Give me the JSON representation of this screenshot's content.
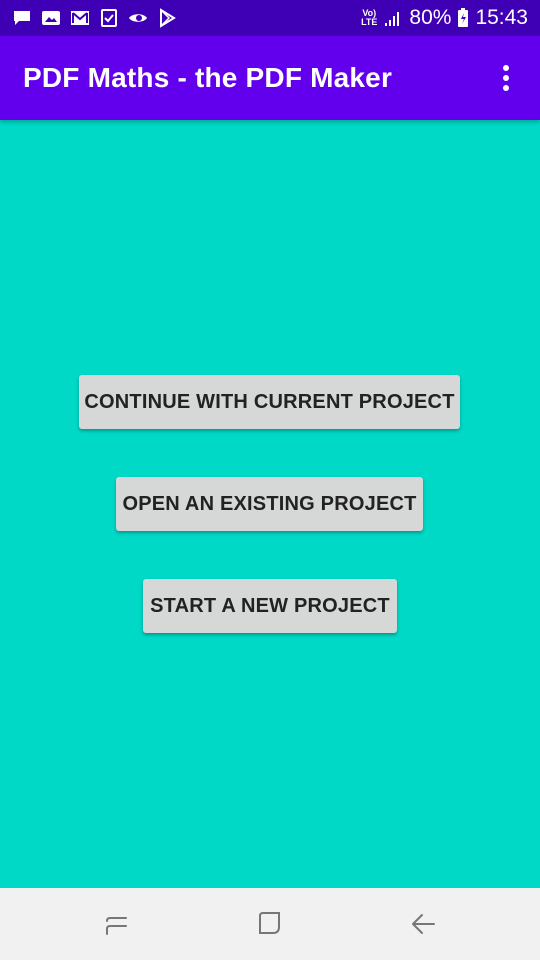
{
  "status_bar": {
    "icons": [
      "message-icon",
      "image-notification-icon",
      "gmail-icon",
      "checkbox-icon",
      "eye-icon",
      "play-store-icon"
    ],
    "volte_label_top": "Vo)",
    "volte_label_bottom": "LTE",
    "battery_percent": "80%",
    "time": "15:43"
  },
  "app_bar": {
    "title": "PDF Maths - the PDF Maker",
    "color": "#6200ee"
  },
  "main": {
    "background": "#00d9c6",
    "buttons": {
      "continue_label": "CONTINUE WITH CURRENT PROJECT",
      "open_label": "OPEN AN EXISTING PROJECT",
      "new_label": "START A NEW PROJECT"
    }
  },
  "nav_bar": {
    "buttons": [
      "recents-icon",
      "home-icon",
      "back-icon"
    ]
  }
}
